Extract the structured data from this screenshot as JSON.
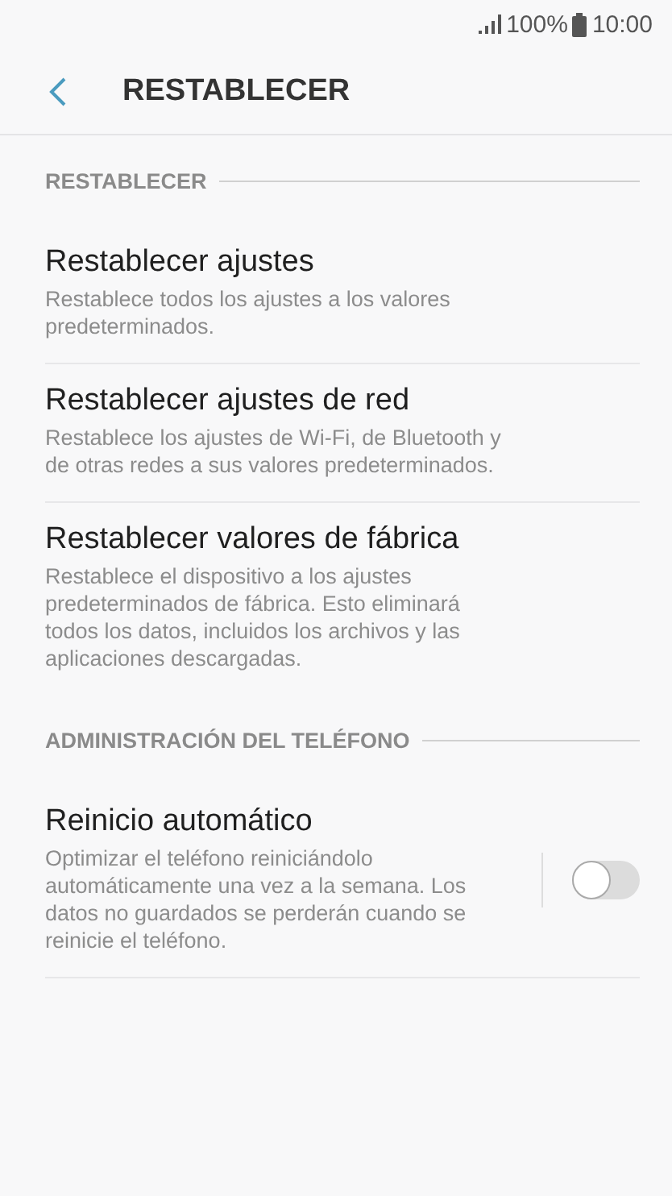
{
  "status_bar": {
    "battery": "100%",
    "time": "10:00"
  },
  "header": {
    "title": "RESTABLECER"
  },
  "sections": [
    {
      "title": "RESTABLECER",
      "items": [
        {
          "kind": "plain",
          "title": "Restablecer ajustes",
          "description": "Restablece todos los ajustes a los valores predeterminados."
        },
        {
          "kind": "plain",
          "title": "Restablecer ajustes de red",
          "description": "Restablece los ajustes de Wi-Fi, de Bluetooth y de otras redes a sus valores predeterminados."
        },
        {
          "kind": "plain",
          "title": "Restablecer valores de fábrica",
          "description": "Restablece el dispositivo a los ajustes predeterminados de fábrica. Esto eliminará todos los datos, incluidos los archivos y las aplicaciones descargadas."
        }
      ]
    },
    {
      "title": "ADMINISTRACIÓN DEL TELÉFONO",
      "items": [
        {
          "kind": "toggle",
          "title": "Reinicio automático",
          "description": "Optimizar el teléfono reiniciándolo automáticamente una vez a la semana. Los datos no guardados se perderán cuando se reinicie el teléfono.",
          "on": false
        }
      ]
    }
  ]
}
